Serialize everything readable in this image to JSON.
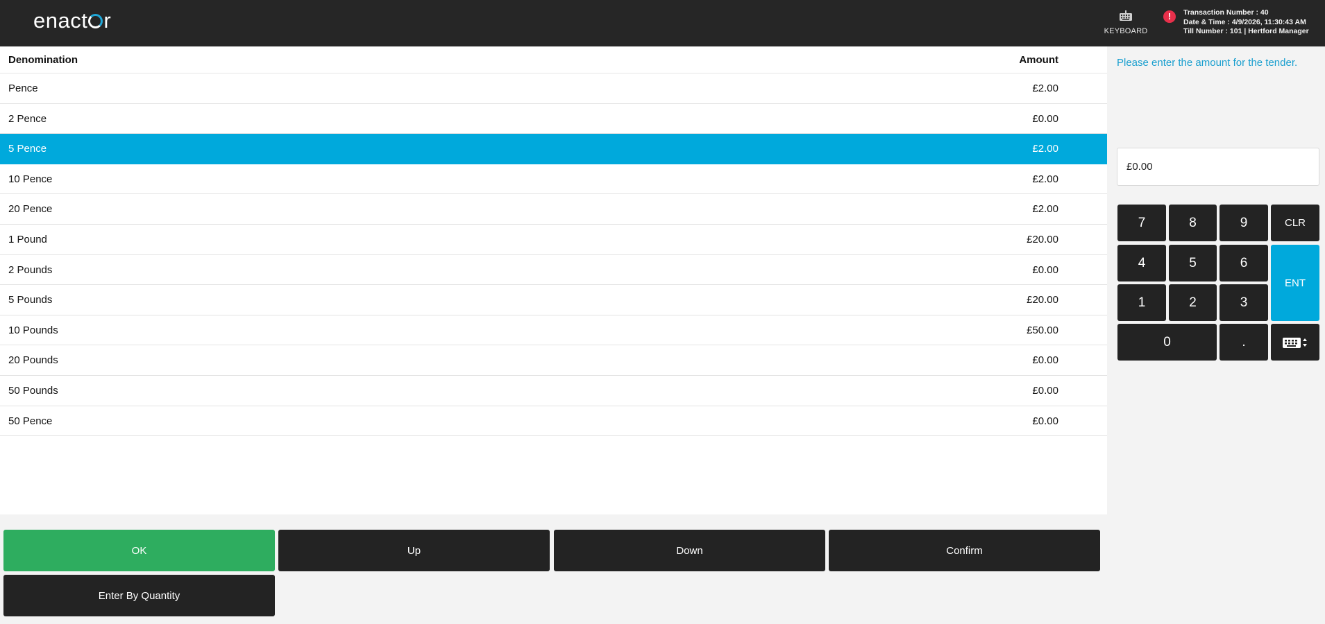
{
  "header": {
    "logo_text": "enactor",
    "keyboard_label": "KEYBOARD",
    "transaction_number": "Transaction Number : 40",
    "date_time": "Date & Time : 4/9/2026, 11:30:43 AM",
    "till_number": "Till Number : 101 | Hertford Manager"
  },
  "table": {
    "columns": {
      "denomination": "Denomination",
      "amount": "Amount"
    },
    "selected_index": 2,
    "rows": [
      {
        "denomination": "Pence",
        "amount": "£2.00"
      },
      {
        "denomination": "2 Pence",
        "amount": "£0.00"
      },
      {
        "denomination": "5 Pence",
        "amount": "£2.00"
      },
      {
        "denomination": "10 Pence",
        "amount": "£2.00"
      },
      {
        "denomination": "20 Pence",
        "amount": "£2.00"
      },
      {
        "denomination": "1 Pound",
        "amount": "£20.00"
      },
      {
        "denomination": "2 Pounds",
        "amount": "£0.00"
      },
      {
        "denomination": "5 Pounds",
        "amount": "£20.00"
      },
      {
        "denomination": "10 Pounds",
        "amount": "£50.00"
      },
      {
        "denomination": "20 Pounds",
        "amount": "£0.00"
      },
      {
        "denomination": "50 Pounds",
        "amount": "£0.00"
      },
      {
        "denomination": "50 Pence",
        "amount": "£0.00"
      }
    ]
  },
  "panel": {
    "prompt": "Please enter the amount for the tender.",
    "amount_value": "£0.00"
  },
  "keypad": {
    "k7": "7",
    "k8": "8",
    "k9": "9",
    "clr": "CLR",
    "k4": "4",
    "k5": "5",
    "k6": "6",
    "ent": "ENT",
    "k1": "1",
    "k2": "2",
    "k3": "3",
    "k0": "0",
    "dot": "."
  },
  "actions": {
    "ok": "OK",
    "up": "Up",
    "down": "Down",
    "confirm": "Confirm",
    "enter_by_quantity": "Enter By Quantity"
  },
  "colors": {
    "header_bg": "#262626",
    "accent": "#00a9dc",
    "ok_green": "#2ead5f",
    "key_dark": "#232323",
    "alert_red": "#e8304b"
  }
}
